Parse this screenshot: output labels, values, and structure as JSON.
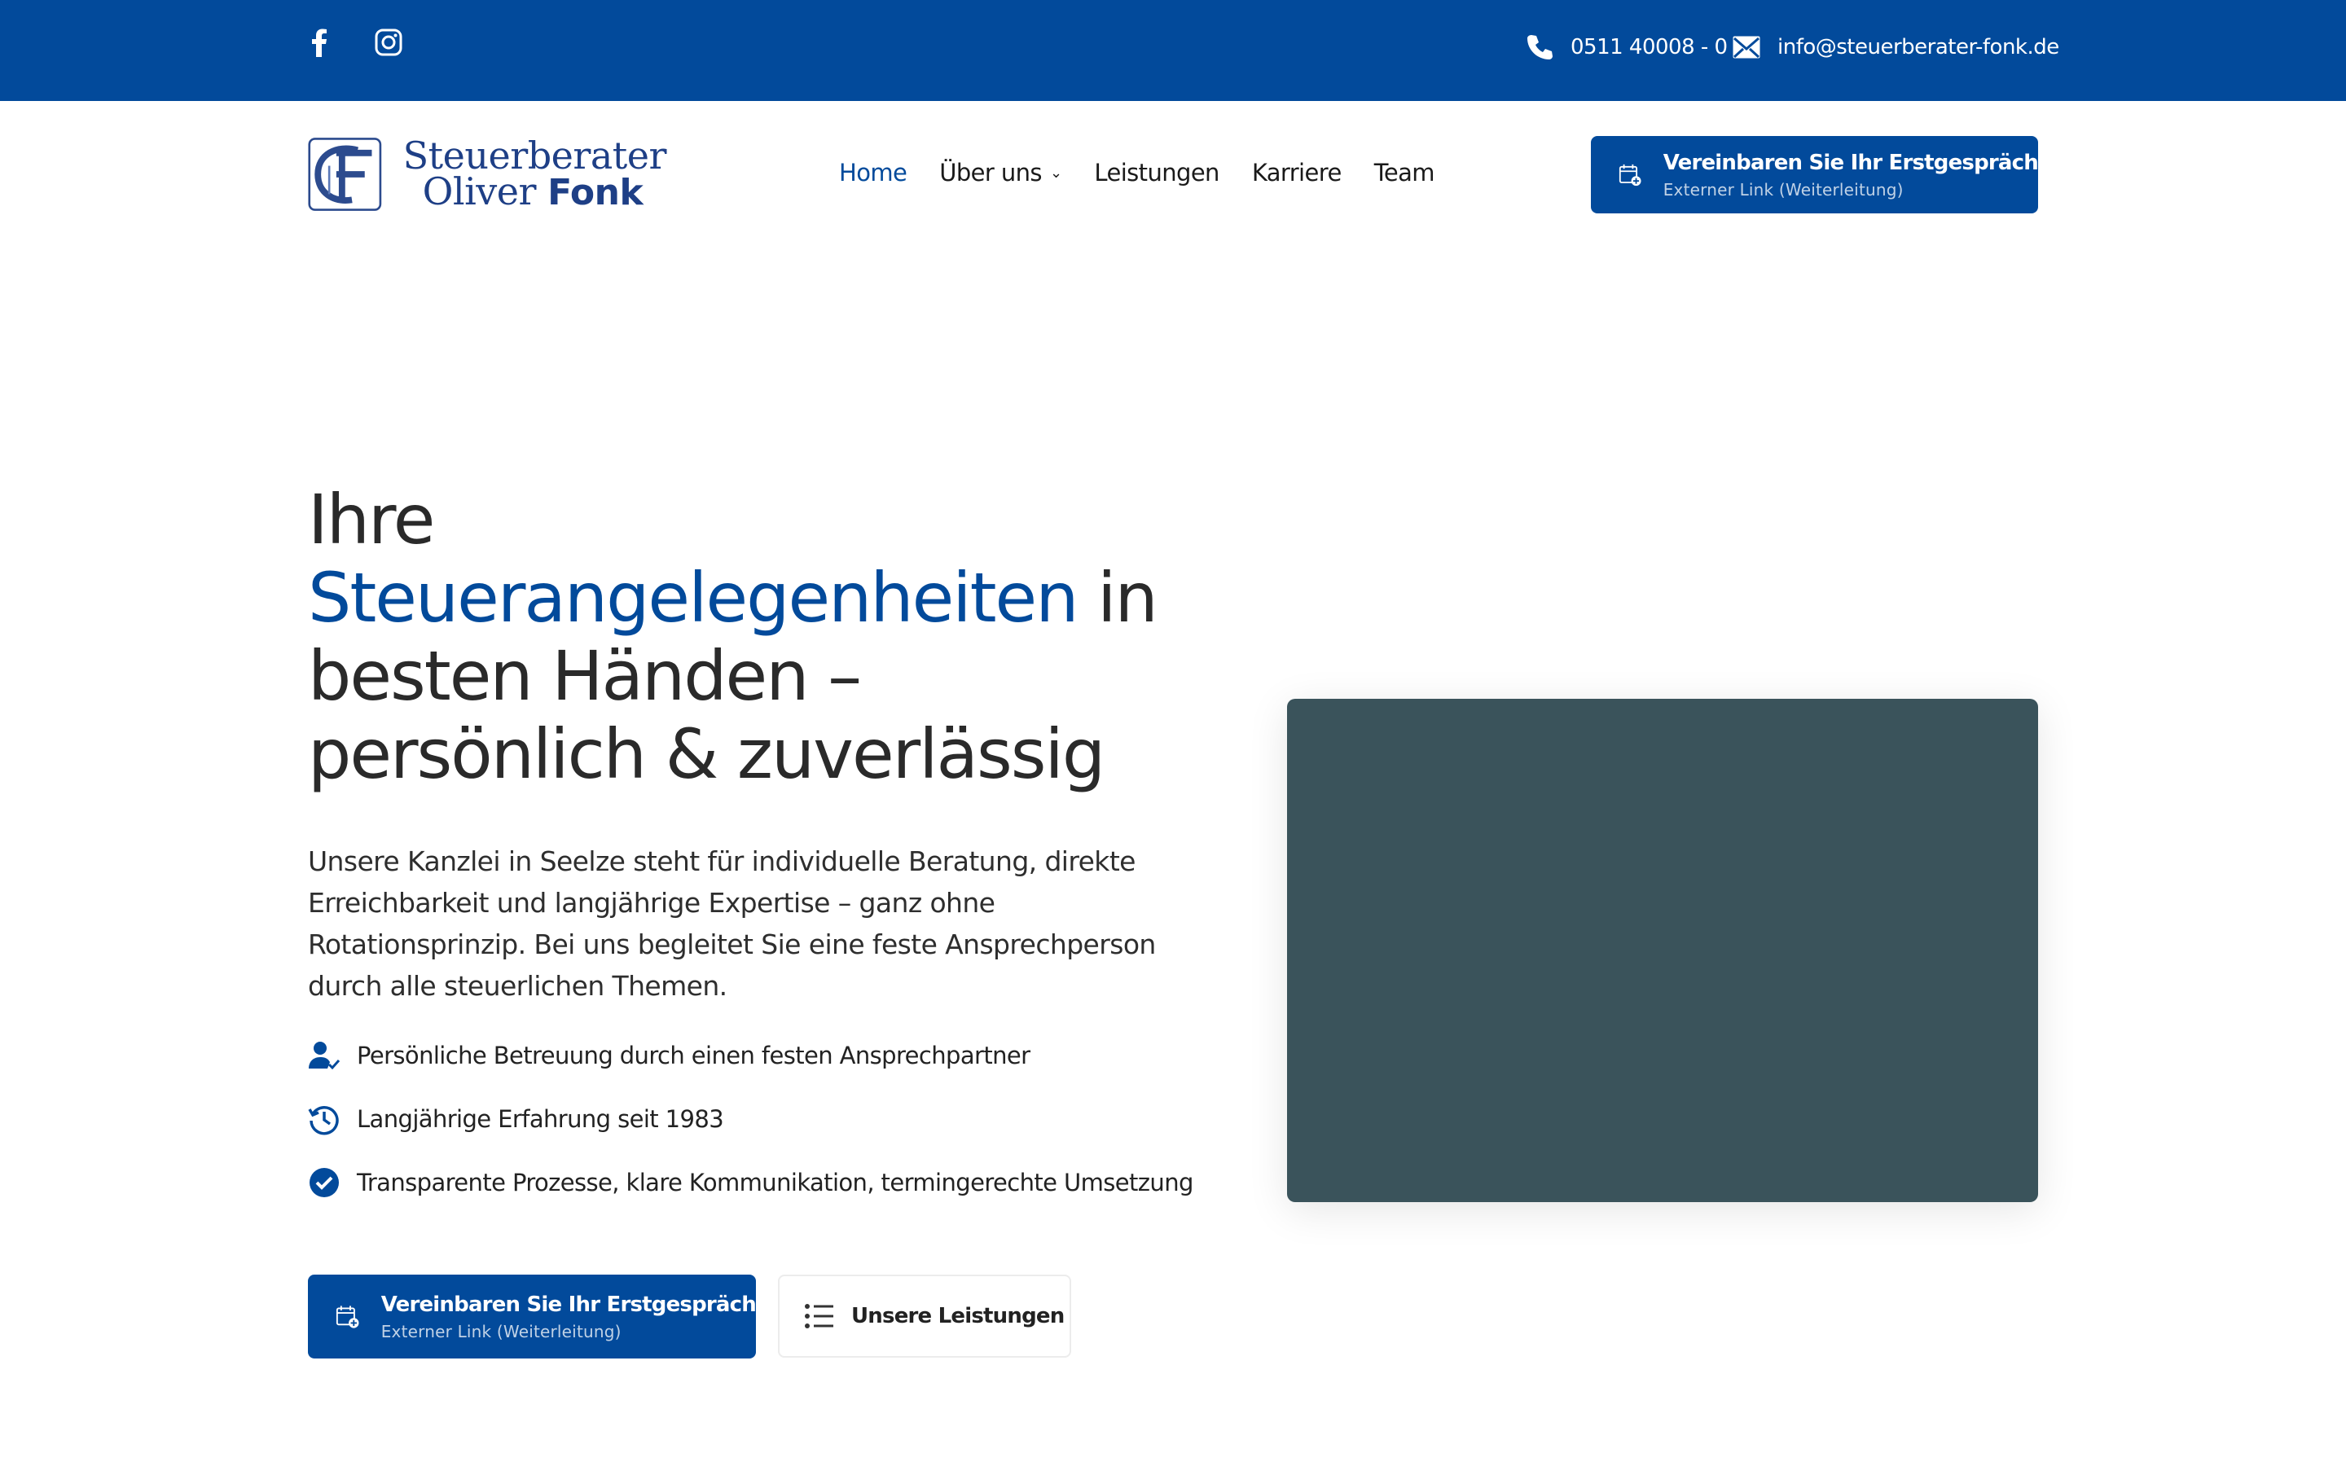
{
  "topbar": {
    "social": [
      {
        "icon": "facebook-icon"
      },
      {
        "icon": "instagram-icon"
      }
    ],
    "phone": "0511 40008 - 0",
    "email": "info@steuerberater-fonk.de"
  },
  "logo": {
    "line1": "Steuerberater",
    "line2a": "Oliver",
    "line2b": "Fonk"
  },
  "nav": {
    "home": "Home",
    "about": "Über uns",
    "services": "Leistungen",
    "careers": "Karriere",
    "team": "Team"
  },
  "header_cta": {
    "title": "Vereinbaren Sie Ihr Erstgespräch",
    "subtitle": "Externer Link (Weiterleitung)"
  },
  "hero": {
    "line1": "Ihre",
    "highlight": "Steuerangelegenheiten",
    "line2_rest": "in",
    "line3": "besten Händen –",
    "line4": "persönlich & zuverlässig",
    "intro": "Unsere Kanzlei in Seelze steht für individuelle Beratung, direkte Erreichbarkeit und langjährige Expertise – ganz ohne Rotationsprinzip. Bei uns begleitet Sie eine feste Ansprechperson durch alle steuerlichen Themen.",
    "features": [
      {
        "icon": "person-check-icon",
        "text": "Persönliche Betreuung durch einen festen Ansprechpartner"
      },
      {
        "icon": "clock-history-icon",
        "text": "Langjährige Erfahrung seit 1983"
      },
      {
        "icon": "check-circle-icon",
        "text": "Transparente Prozesse, klare Kommunikation, termingerechte Umsetzung"
      }
    ],
    "cta_primary": {
      "title": "Vereinbaren Sie Ihr Erstgespräch",
      "subtitle": "Externer Link (Weiterleitung)"
    },
    "cta_secondary": "Unsere Leistungen"
  },
  "colors": {
    "brand": "#024a9b",
    "media_placeholder": "#3a535b"
  }
}
